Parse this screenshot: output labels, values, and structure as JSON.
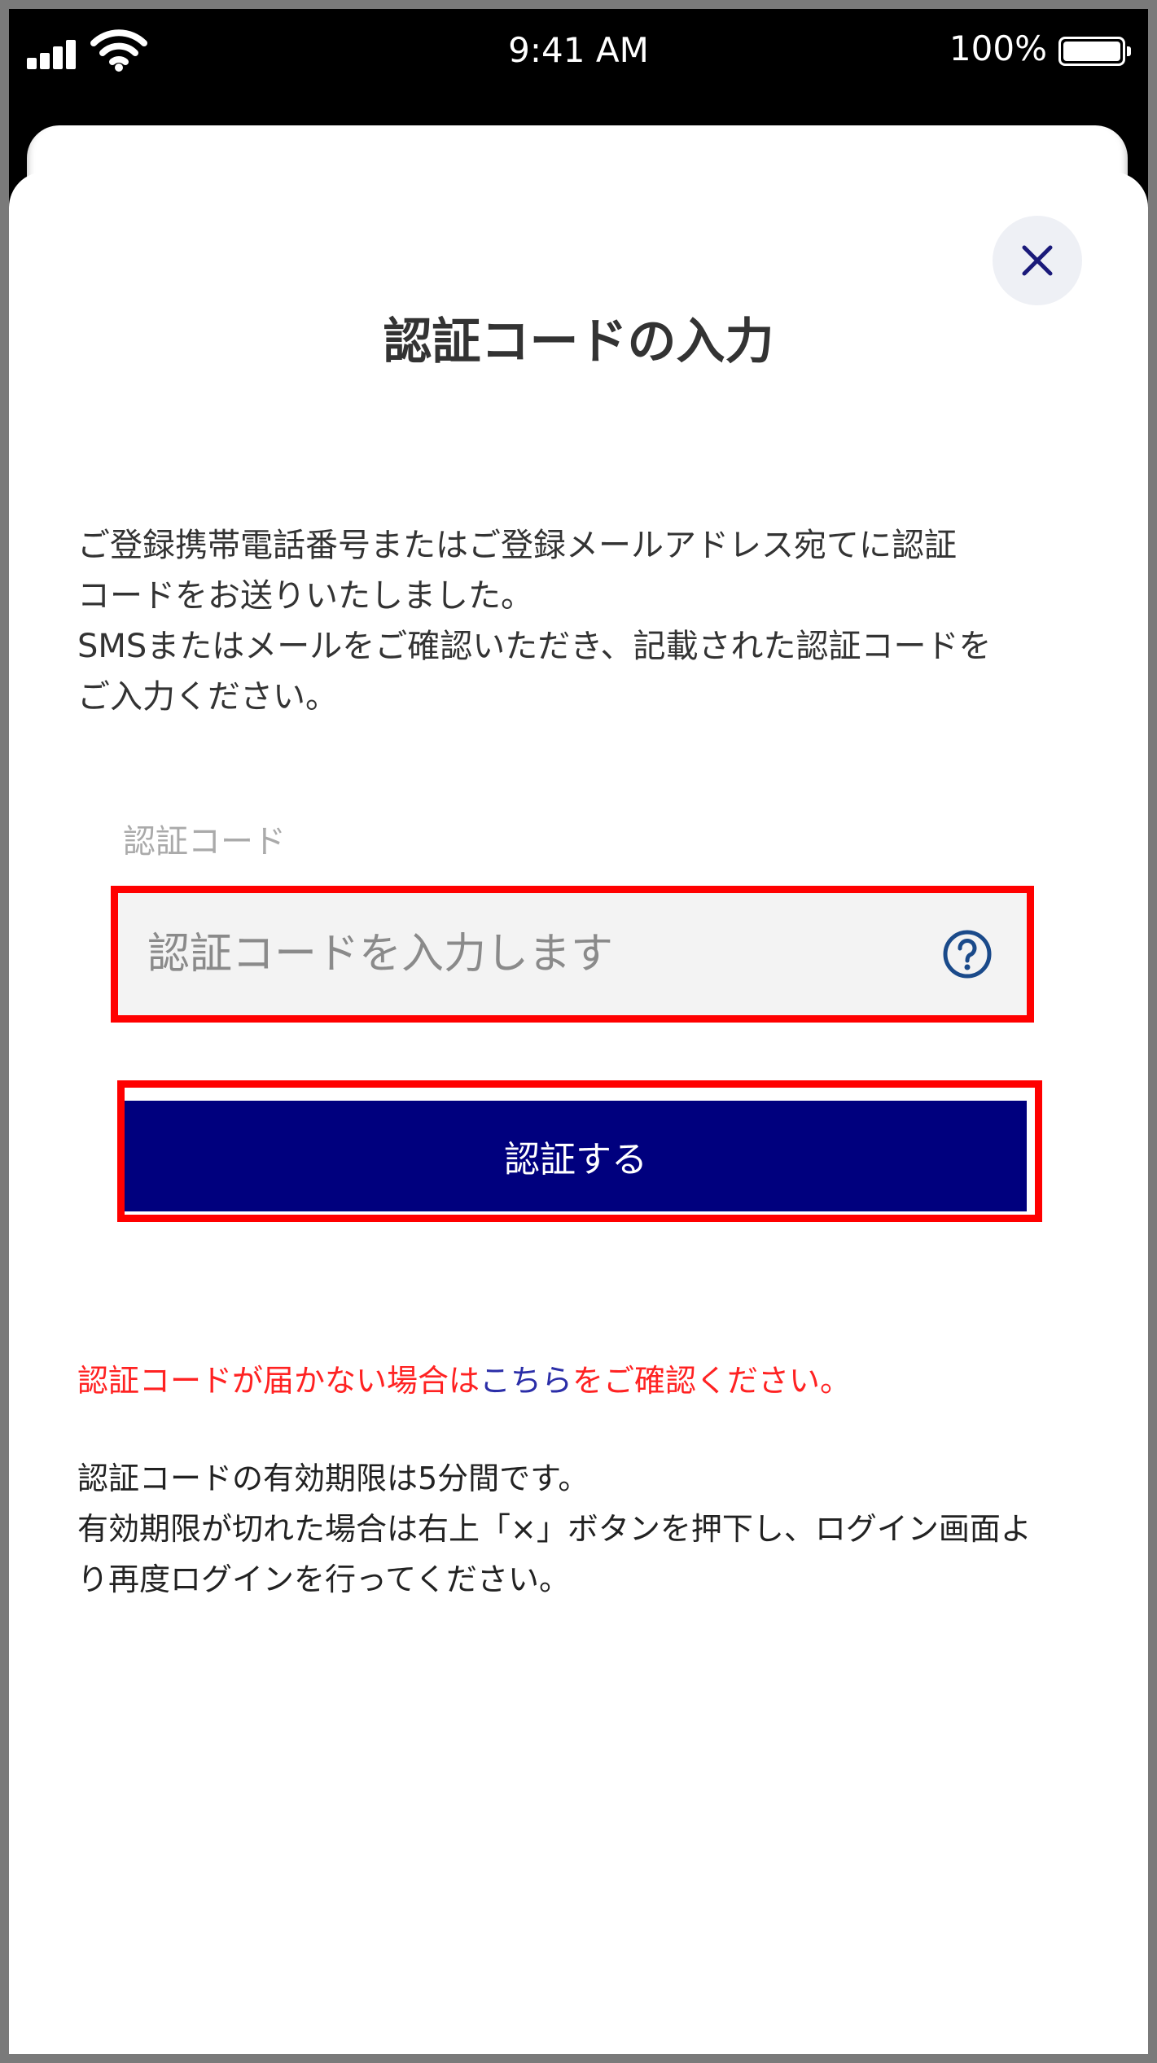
{
  "status_bar": {
    "time": "9:41 AM",
    "battery_percent": "100%",
    "icons": [
      "signal-icon",
      "wifi-icon",
      "battery-icon"
    ]
  },
  "modal": {
    "title": "認証コードの入力",
    "description": [
      "ご登録携帯電話番号またはご登録メールアドレス宛てに認証",
      "コードをお送りいたしました。",
      "SMSまたはメールをご確認いただき、記載された認証コードを",
      "ご入力ください。"
    ],
    "field_label": "認証コード",
    "input_placeholder": "認証コードを入力します",
    "submit_label": "認証する",
    "notice": {
      "before": "認証コードが届かない場合は",
      "link": "こちら",
      "after": "をご確認ください。"
    },
    "expiry": [
      "認証コードの有効期限は5分間です。",
      "有効期限が切れた場合は右上「×」ボタンを押下し、ログイン画面よ",
      "り再度ログインを行ってください。"
    ]
  },
  "colors": {
    "primary": "#00007e",
    "highlight": "#ff0000",
    "notice": "#ff2222",
    "link": "#2b2ea8"
  }
}
